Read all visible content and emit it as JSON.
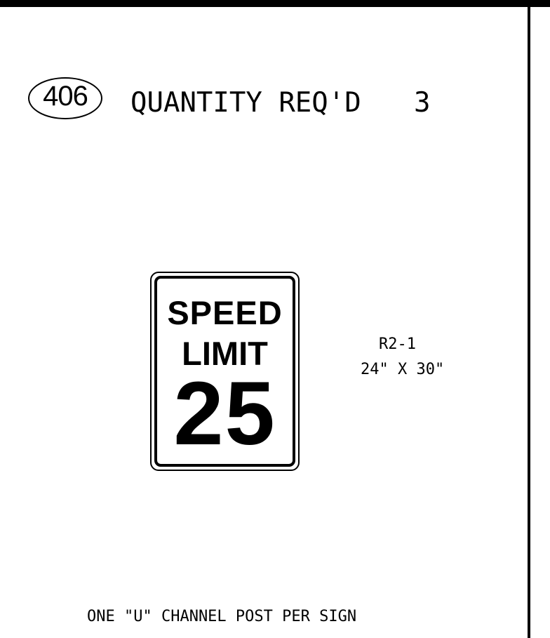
{
  "header": {
    "item_number": "406",
    "quantity_label": "QUANTITY REQ'D",
    "quantity_value": "3"
  },
  "sign": {
    "line1": "SPEED",
    "line2": "LIMIT",
    "speed_value": "25",
    "code": "R2-1",
    "size": "24\" X 30\""
  },
  "footer": {
    "post_note": "ONE \"U\" CHANNEL POST PER SIGN"
  },
  "colors": {
    "ink": "#000000",
    "paper": "#ffffff"
  }
}
